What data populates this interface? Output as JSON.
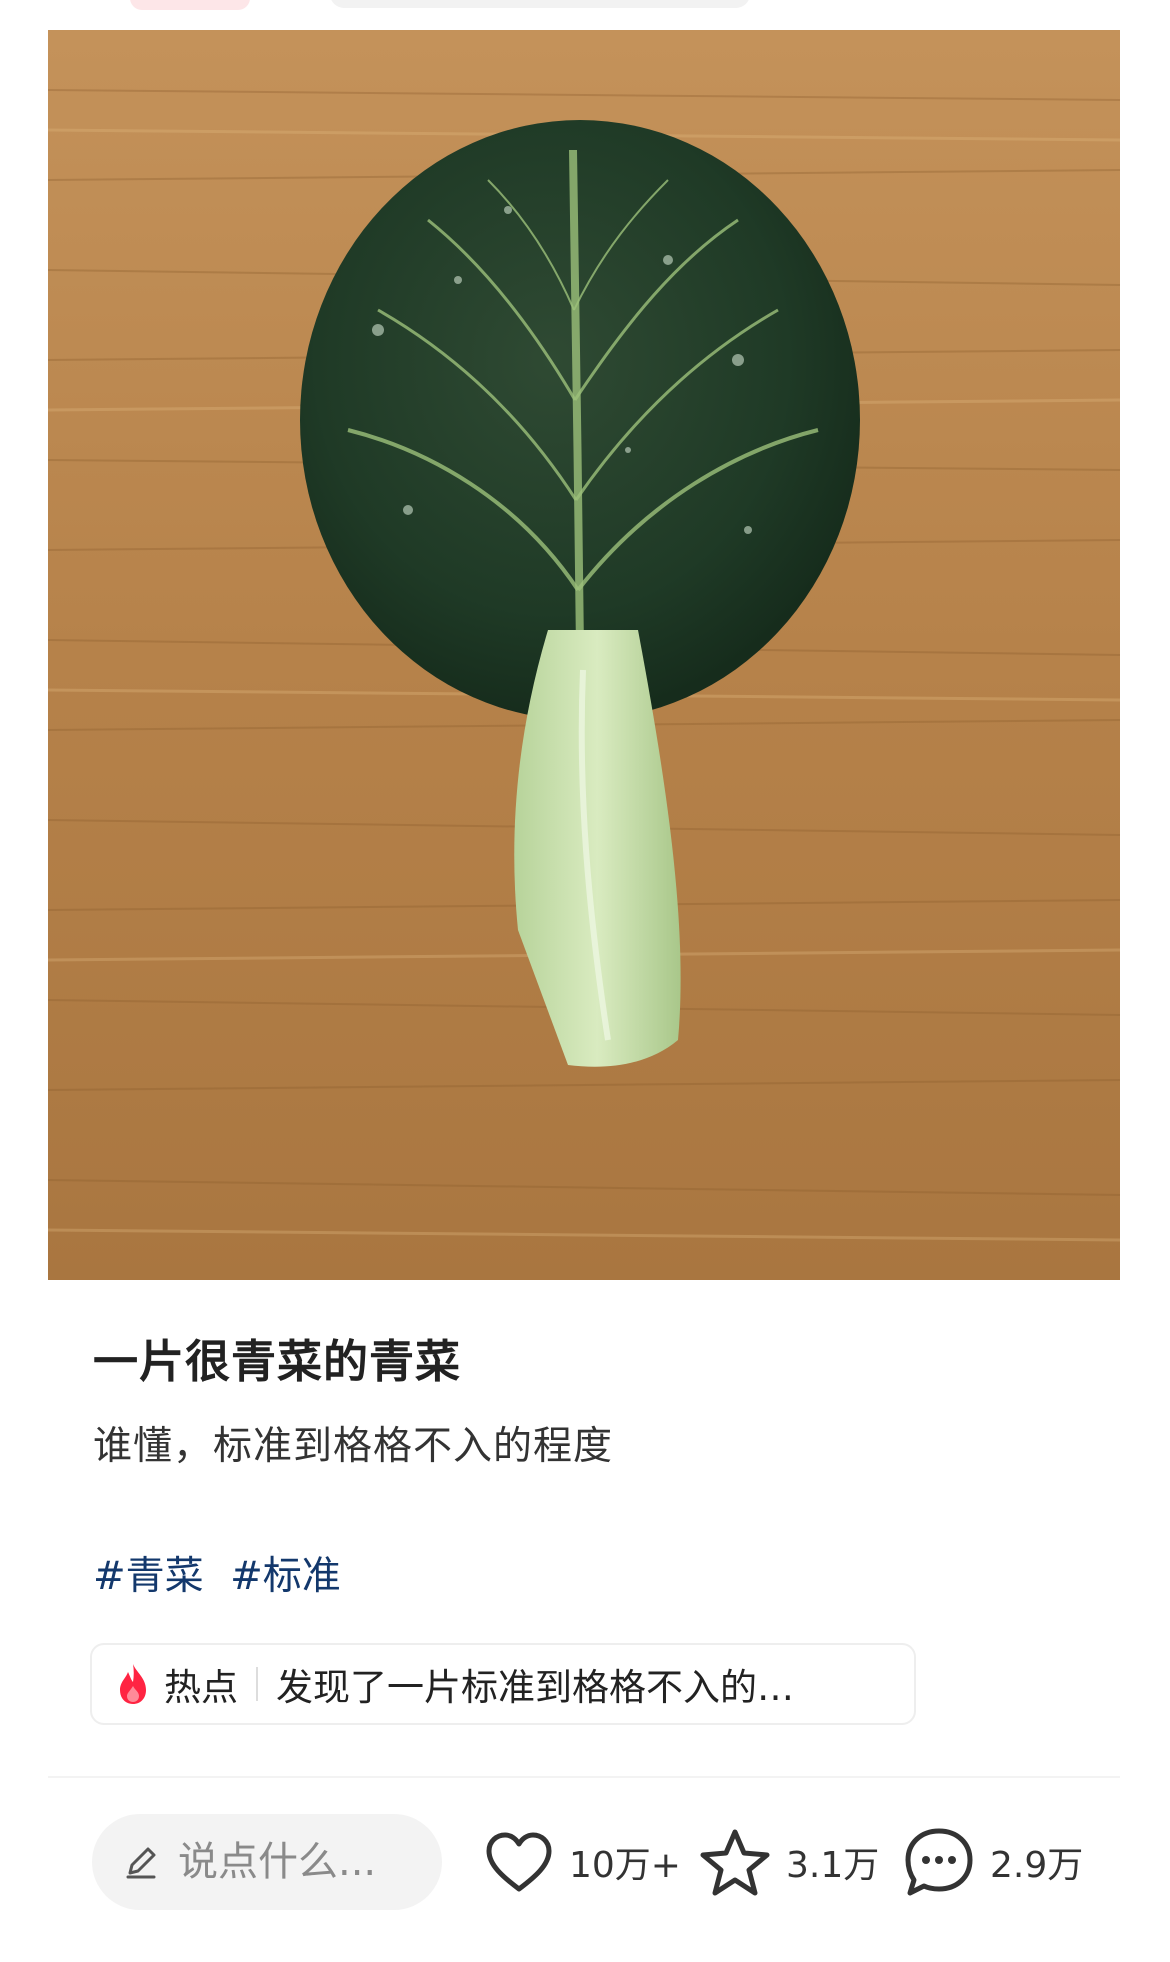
{
  "post": {
    "title": "一片很青菜的青菜",
    "description": "谁懂，标准到格格不入的程度",
    "tags": [
      "#青菜",
      "#标准"
    ]
  },
  "hot_topic": {
    "label": "热点",
    "text": "发现了一片标准到格格不入的…"
  },
  "bottom_bar": {
    "comment_placeholder": "说点什么...",
    "likes": "10万+",
    "collects": "3.1万",
    "comments": "2.9万"
  },
  "colors": {
    "tag": "#13386c",
    "fire": "#ff2442",
    "wood": "#b9874a"
  },
  "icons": [
    "pen-icon",
    "heart-icon",
    "star-icon",
    "comment-bubble-icon",
    "fire-icon"
  ]
}
